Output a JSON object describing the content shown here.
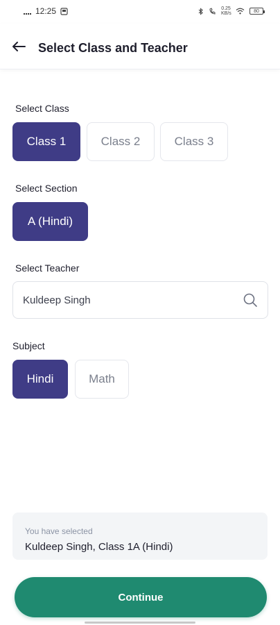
{
  "status_bar": {
    "time": "12:25",
    "network_speed": "0.25 KB/s",
    "battery": "80"
  },
  "header": {
    "title": "Select Class and Teacher"
  },
  "class_section": {
    "label": "Select Class",
    "options": [
      "Class 1",
      "Class 2",
      "Class 3"
    ],
    "selected": "Class 1"
  },
  "section_section": {
    "label": "Select Section",
    "options": [
      "A (Hindi)"
    ],
    "selected": "A (Hindi)"
  },
  "teacher_section": {
    "label": "Select Teacher",
    "value": "Kuldeep Singh"
  },
  "subject_section": {
    "label": "Subject",
    "options": [
      "Hindi",
      "Math"
    ],
    "selected": "Hindi"
  },
  "summary": {
    "caption": "You have selected",
    "value": "Kuldeep Singh, Class 1A (Hindi)"
  },
  "actions": {
    "continue_label": "Continue"
  },
  "colors": {
    "selected_chip": "#3f3c86",
    "primary_button": "#1f8a70",
    "summary_bg": "#f3f5f7"
  }
}
